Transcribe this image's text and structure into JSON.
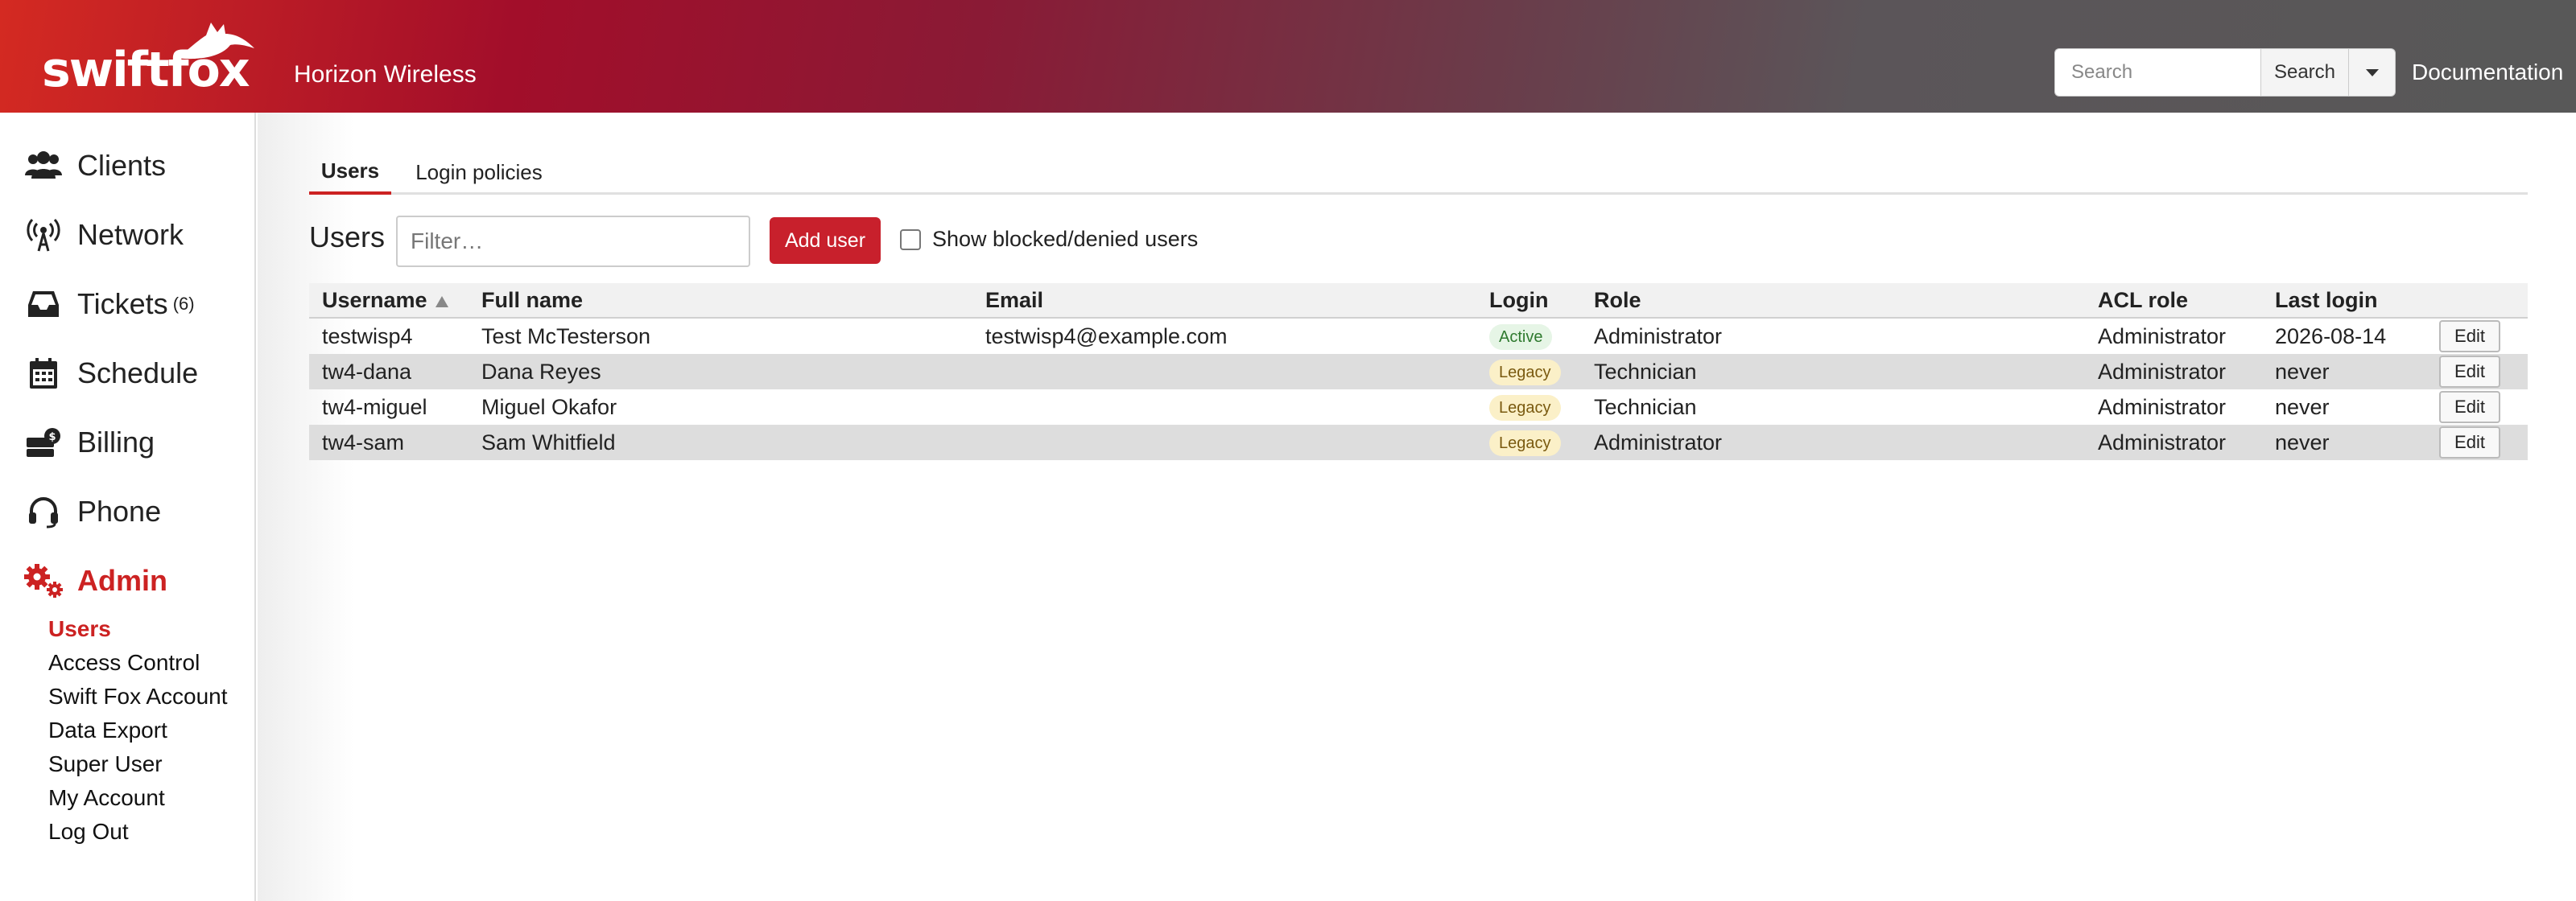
{
  "brand": {
    "logo_text": "swiftfox",
    "org_name": "Horizon Wireless"
  },
  "header": {
    "search_placeholder": "Search",
    "search_label": "Search",
    "documentation_label": "Documentation"
  },
  "sidebar": {
    "items": [
      {
        "label": "Clients",
        "icon": "users-icon"
      },
      {
        "label": "Network",
        "icon": "antenna-icon"
      },
      {
        "label": "Tickets",
        "icon": "inbox-icon",
        "count": "(6)"
      },
      {
        "label": "Schedule",
        "icon": "calendar-icon"
      },
      {
        "label": "Billing",
        "icon": "money-icon"
      },
      {
        "label": "Phone",
        "icon": "headset-icon"
      },
      {
        "label": "Admin",
        "icon": "gears-icon",
        "active": true
      }
    ],
    "admin_sub": [
      "Users",
      "Access Control",
      "Swift Fox Account",
      "Data Export",
      "Super User",
      "My Account",
      "Log Out"
    ]
  },
  "tabs": [
    "Users",
    "Login policies"
  ],
  "users": {
    "heading": "Users",
    "filter_placeholder": "Filter…",
    "add_label": "Add user",
    "show_blocked_label": "Show blocked/denied users",
    "columns": [
      "Username",
      "Full name",
      "Email",
      "Login",
      "Role",
      "ACL role",
      "Last login"
    ],
    "edit_label": "Edit",
    "rows": [
      {
        "username": "testwisp4",
        "full_name": "Test McTesterson",
        "email": "testwisp4@example.com",
        "login": "Active",
        "role": "Administrator",
        "acl_role": "Administrator",
        "last_login": "2026-08-14"
      },
      {
        "username": "tw4-dana",
        "full_name": "Dana Reyes",
        "email": "",
        "login": "Legacy",
        "role": "Technician",
        "acl_role": "Administrator",
        "last_login": "never"
      },
      {
        "username": "tw4-miguel",
        "full_name": "Miguel Okafor",
        "email": "",
        "login": "Legacy",
        "role": "Technician",
        "acl_role": "Administrator",
        "last_login": "never"
      },
      {
        "username": "tw4-sam",
        "full_name": "Sam Whitfield",
        "email": "",
        "login": "Legacy",
        "role": "Administrator",
        "acl_role": "Administrator",
        "last_login": "never"
      }
    ]
  },
  "colors": {
    "accent": "#cc2222",
    "active_badge": "#e6f5e6",
    "legacy_badge": "#fbf0c8"
  }
}
